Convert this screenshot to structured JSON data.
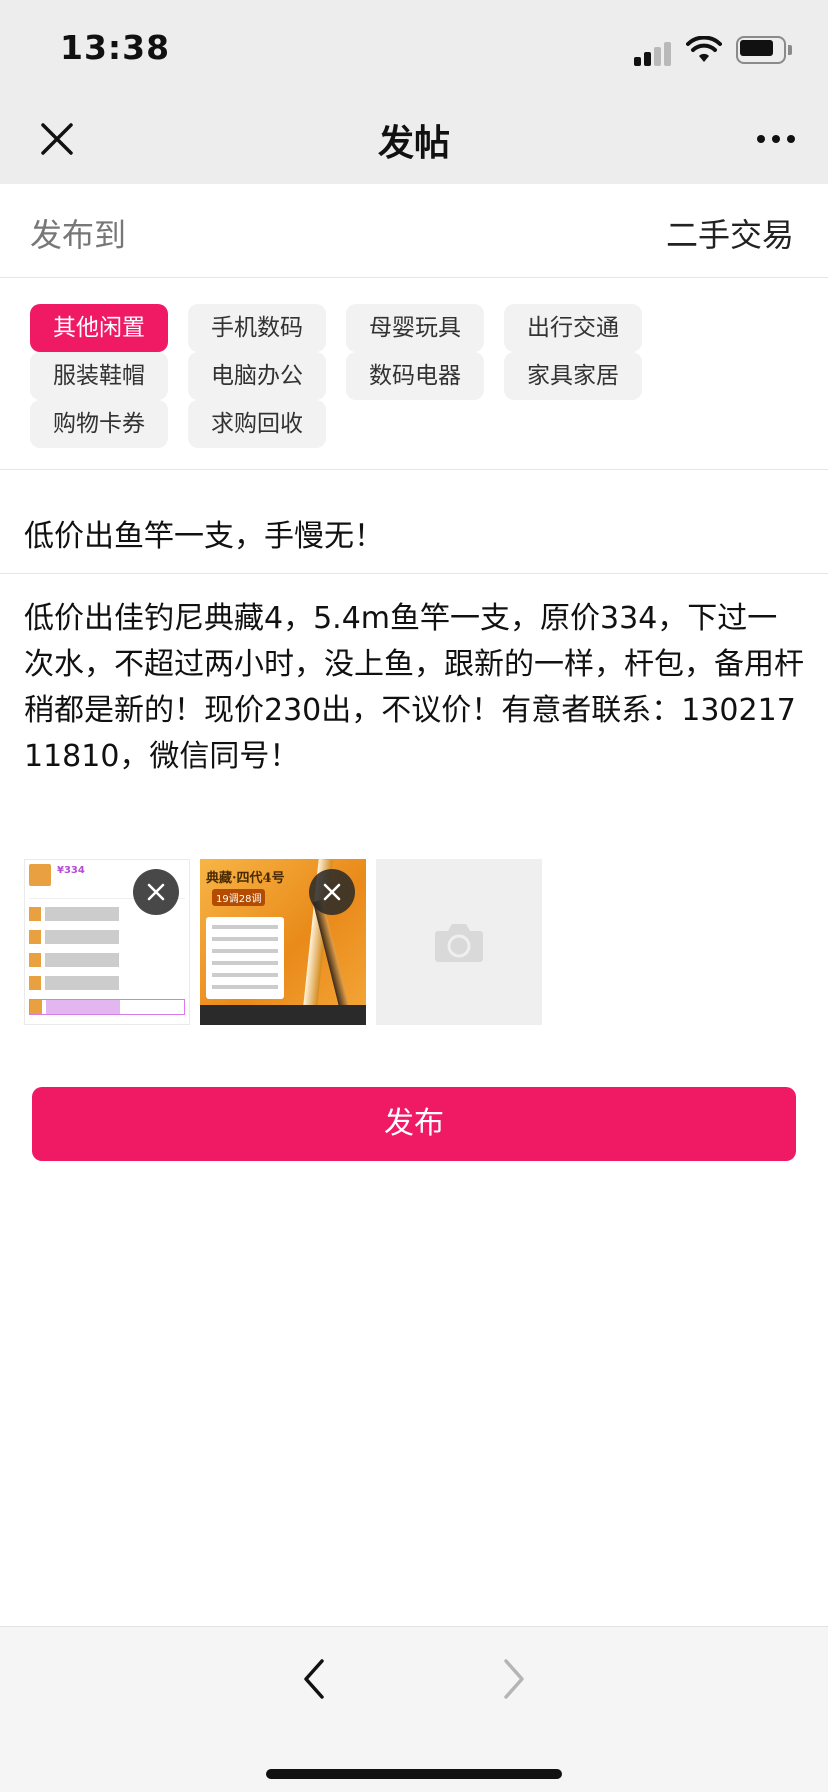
{
  "status_bar": {
    "time": "13:38"
  },
  "nav": {
    "title": "发帖"
  },
  "publish_to": {
    "label": "发布到",
    "value": "二手交易"
  },
  "categories": [
    {
      "label": "其他闲置",
      "selected": true
    },
    {
      "label": "手机数码",
      "selected": false
    },
    {
      "label": "母婴玩具",
      "selected": false
    },
    {
      "label": "出行交通",
      "selected": false
    },
    {
      "label": "服装鞋帽",
      "selected": false
    },
    {
      "label": "电脑办公",
      "selected": false
    },
    {
      "label": "数码电器",
      "selected": false
    },
    {
      "label": "家具家居",
      "selected": false
    },
    {
      "label": "购物卡券",
      "selected": false
    },
    {
      "label": "求购回收",
      "selected": false
    }
  ],
  "post": {
    "title": "低价出鱼竿一支，手慢无！",
    "body": "低价出佳钓尼典藏4，5.4m鱼竿一支，原价334，下过一次水，不超过两小时，没上鱼，跟新的一样，杆包，备用杆稍都是新的！现价230出，不议价！有意者联系：13021711810，微信同号！"
  },
  "images": {
    "thumb1": {
      "price": "¥334"
    },
    "thumb2": {
      "title": "典藏·四代4号",
      "subtitle": "19调28调"
    }
  },
  "publish_button": {
    "label": "发布"
  },
  "colors": {
    "accent": "#ef1a63",
    "bar_bg": "#ededed",
    "chip_bg": "#f2f2f2"
  },
  "icons": [
    "close-icon",
    "more-icon",
    "camera-icon",
    "remove-image-icon",
    "back-arrow-icon",
    "forward-arrow-icon"
  ]
}
